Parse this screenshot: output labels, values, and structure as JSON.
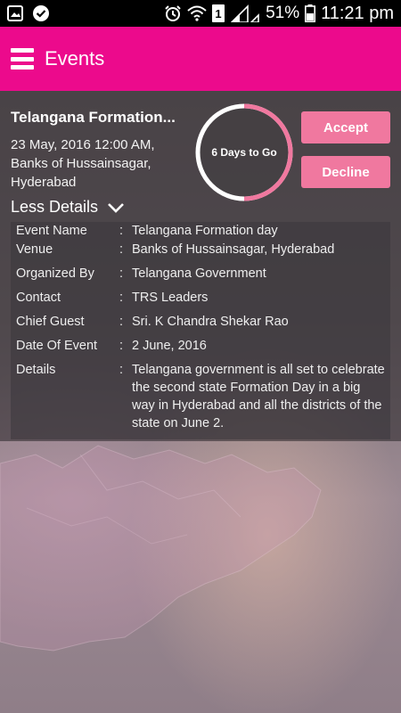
{
  "status_bar": {
    "battery_percent": "51%",
    "time": "11:21 pm",
    "icons": [
      "image-icon",
      "check-badge-icon",
      "alarm-icon",
      "wifi-icon",
      "sim-1-icon",
      "signal-icon",
      "battery-icon"
    ]
  },
  "app_bar": {
    "title": "Events",
    "color": "#ec0a8c"
  },
  "event": {
    "title": "Telangana Formation...",
    "datetime": "23 May, 2016 12:00 AM,",
    "location_line1": "Banks of Hussainsagar,",
    "location_line2": "Hyderabad",
    "countdown": "6 Days to Go",
    "accept_label": "Accept",
    "decline_label": "Decline",
    "less_details_label": "Less Details"
  },
  "details": [
    {
      "label": "Event Name",
      "value": "Telangana Formation day"
    },
    {
      "label": "Venue",
      "value": "Banks of Hussainsagar, Hyderabad"
    },
    {
      "label": "Organized By",
      "value": "Telangana Government"
    },
    {
      "label": "Contact",
      "value": "TRS Leaders"
    },
    {
      "label": "Chief Guest",
      "value": "Sri. K Chandra Shekar Rao"
    },
    {
      "label": "Date Of Event",
      "value": "2 June, 2016"
    },
    {
      "label": "Details",
      "value": "Telangana government is all set to celebrate the second state Formation Day in a big way in Hyderabad and all the districts of the state on June 2."
    }
  ],
  "separator": ":",
  "colors": {
    "accent": "#ec0a8c",
    "button": "#f0789f",
    "ring_track": "#ffffff",
    "ring_progress": "#f0789f"
  }
}
